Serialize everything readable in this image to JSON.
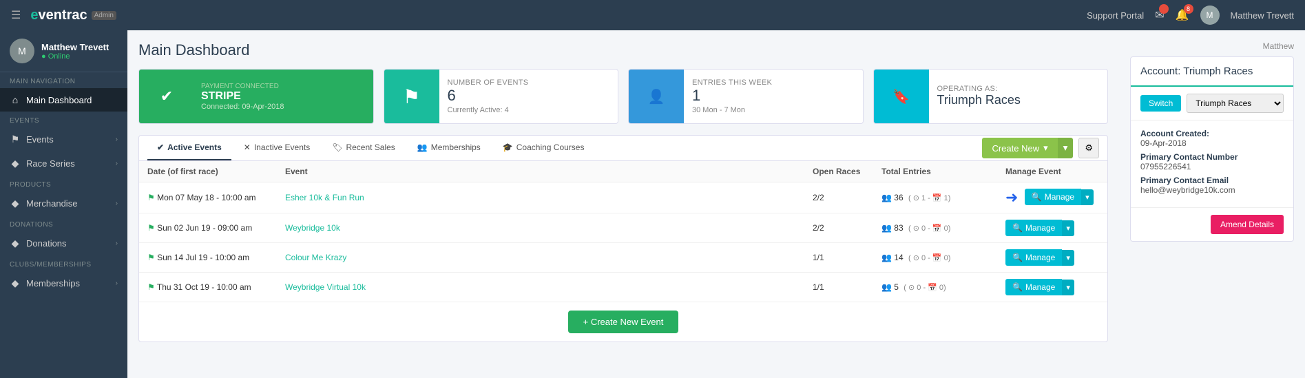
{
  "topnav": {
    "logo": "eventrac",
    "logo_e": "e",
    "admin_badge": "Admin",
    "hamburger": "☰",
    "support_portal": "Support Portal",
    "user_name": "Matthew Trevett",
    "notification_badge": "8",
    "user_initial": "M"
  },
  "sidebar": {
    "username": "Matthew Trevett",
    "status": "Online",
    "user_initial": "M",
    "sections": [
      {
        "label": "MAIN NAVIGATION",
        "items": [
          {
            "id": "main-dashboard",
            "icon": "⌂",
            "label": "Main Dashboard",
            "active": true,
            "has_chevron": false
          }
        ]
      },
      {
        "label": "Events",
        "items": [
          {
            "id": "events",
            "icon": "⚑",
            "label": "Events",
            "active": false,
            "has_chevron": true
          },
          {
            "id": "race-series",
            "icon": "♦",
            "label": "Race Series",
            "active": false,
            "has_chevron": true
          }
        ]
      },
      {
        "label": "Products",
        "items": [
          {
            "id": "merchandise",
            "icon": "♦",
            "label": "Merchandise",
            "active": false,
            "has_chevron": true
          }
        ]
      },
      {
        "label": "Donations",
        "items": [
          {
            "id": "donations",
            "icon": "♦",
            "label": "Donations",
            "active": false,
            "has_chevron": true
          }
        ]
      },
      {
        "label": "Clubs/Memberships",
        "items": [
          {
            "id": "memberships",
            "icon": "♦",
            "label": "Memberships",
            "active": false,
            "has_chevron": true
          }
        ]
      }
    ]
  },
  "page": {
    "title": "Main Dashboard"
  },
  "stats": [
    {
      "id": "payment",
      "icon_color": "green",
      "icon": "✔",
      "label": "PAYMENT CONNECTED",
      "value": "STRIPE",
      "sub": "Connected: 09-Apr-2018",
      "type": "stripe"
    },
    {
      "id": "events",
      "icon_color": "teal",
      "icon": "⚑",
      "label": "NUMBER OF EVENTS",
      "value": "6",
      "sub": "Currently Active: 4"
    },
    {
      "id": "entries",
      "icon_color": "blue",
      "icon": "👤+",
      "label": "ENTRIES THIS WEEK",
      "value": "1",
      "sub": "30 Mon - 7 Mon"
    },
    {
      "id": "operating",
      "icon_color": "cyan",
      "icon": "🔖",
      "label": "OPERATING AS:",
      "value": "Triumph Races",
      "sub": ""
    }
  ],
  "tabs": [
    {
      "id": "active-events",
      "icon": "✔",
      "label": "Active Events",
      "active": true
    },
    {
      "id": "inactive-events",
      "icon": "✕",
      "label": "Inactive Events",
      "active": false
    },
    {
      "id": "recent-sales",
      "icon": "♦",
      "label": "Recent Sales",
      "active": false
    },
    {
      "id": "memberships",
      "icon": "👥",
      "label": "Memberships",
      "active": false
    },
    {
      "id": "coaching-courses",
      "icon": "🎓",
      "label": "Coaching Courses",
      "active": false
    }
  ],
  "toolbar": {
    "create_new_label": "Create New",
    "settings_icon": "⚙"
  },
  "table": {
    "columns": [
      "Date (of first race)",
      "Event",
      "Open Races",
      "Total Entries",
      "Manage Event"
    ],
    "rows": [
      {
        "date": "Mon 07 May 18 - 10:00 am",
        "event": "Esher 10k & Fun Run",
        "event_link": "#",
        "open_races": "2/2",
        "total_entries": "36",
        "entries_detail": "( ⊙ 1 - 📅 1)",
        "highlighted": true
      },
      {
        "date": "Sun 02 Jun 19 - 09:00 am",
        "event": "Weybridge 10k",
        "event_link": "#",
        "open_races": "2/2",
        "total_entries": "83",
        "entries_detail": "( ⊙ 0 - 📅 0)",
        "highlighted": false
      },
      {
        "date": "Sun 14 Jul 19 - 10:00 am",
        "event": "Colour Me Krazy",
        "event_link": "#",
        "open_races": "1/1",
        "total_entries": "14",
        "entries_detail": "( ⊙ 0 - 📅 0)",
        "highlighted": false
      },
      {
        "date": "Thu 31 Oct 19 - 10:00 am",
        "event": "Weybridge Virtual 10k",
        "event_link": "#",
        "open_races": "1/1",
        "total_entries": "5",
        "entries_detail": "( ⊙ 0 - 📅 0)",
        "highlighted": false
      }
    ]
  },
  "create_event_btn": "+ Create New Event",
  "right_sidebar": {
    "user_label": "Matthew",
    "account_title": "Account: Triumph Races",
    "switch_label": "Switch",
    "account_select": "Triumph Races",
    "account_created_label": "Account Created:",
    "account_created_value": "09-Apr-2018",
    "primary_contact_label": "Primary Contact Number",
    "primary_contact_value": "07955226541",
    "primary_email_label": "Primary Contact Email",
    "primary_email_value": "hello@weybridge10k.com",
    "amend_label": "Amend Details"
  }
}
